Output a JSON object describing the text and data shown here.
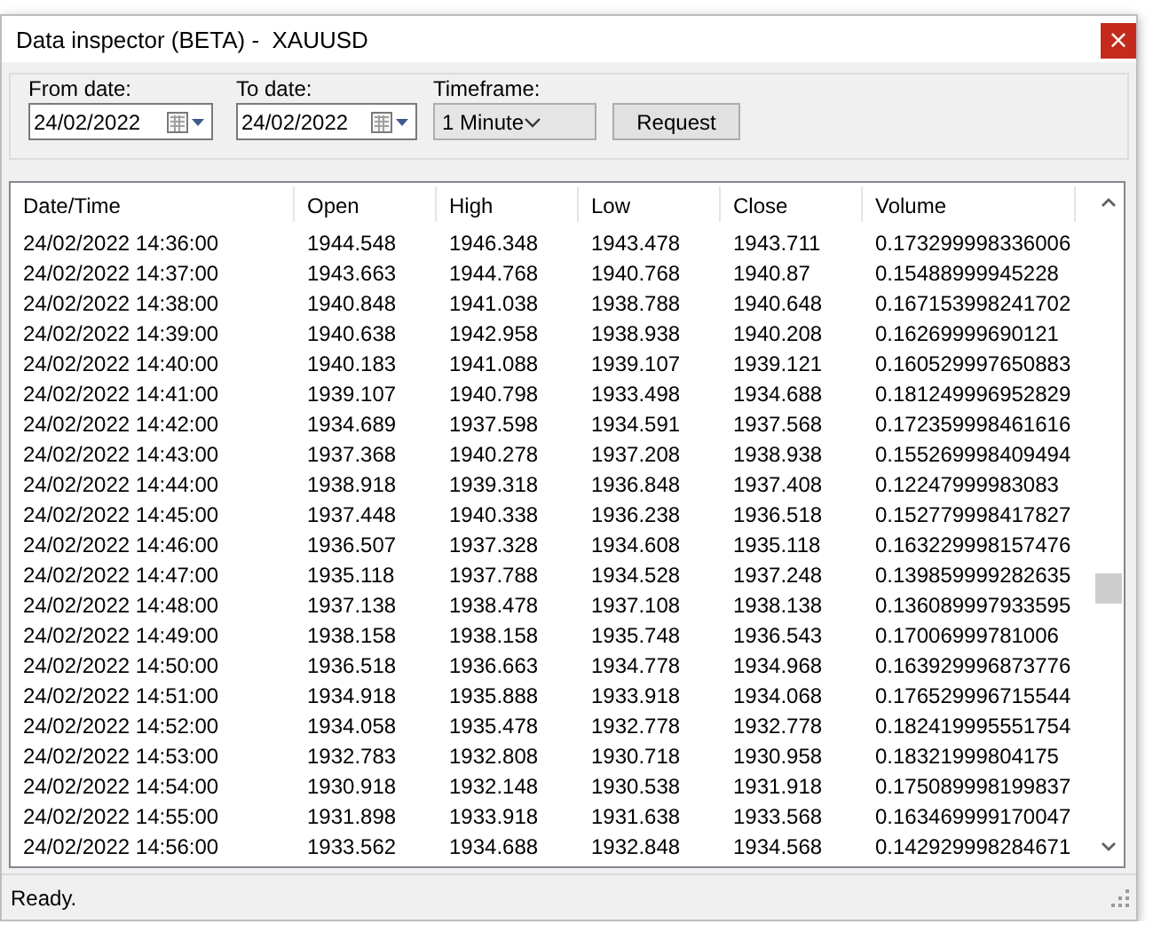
{
  "window": {
    "title": "Data inspector (BETA) -  XAUUSD",
    "close_glyph": "×"
  },
  "toolbar": {
    "from_date": {
      "label": "From date:",
      "value": "24/02/2022"
    },
    "to_date": {
      "label": "To date:",
      "value": "24/02/2022"
    },
    "timeframe": {
      "label": "Timeframe:",
      "value": "1 Minute"
    },
    "request_button": "Request"
  },
  "table": {
    "columns": [
      "Date/Time",
      "Open",
      "High",
      "Low",
      "Close",
      "Volume"
    ],
    "rows": [
      [
        "24/02/2022 14:36:00",
        "1944.548",
        "1946.348",
        "1943.478",
        "1943.711",
        "0.173299998336006"
      ],
      [
        "24/02/2022 14:37:00",
        "1943.663",
        "1944.768",
        "1940.768",
        "1940.87",
        "0.15488999945228"
      ],
      [
        "24/02/2022 14:38:00",
        "1940.848",
        "1941.038",
        "1938.788",
        "1940.648",
        "0.167153998241702"
      ],
      [
        "24/02/2022 14:39:00",
        "1940.638",
        "1942.958",
        "1938.938",
        "1940.208",
        "0.16269999690121"
      ],
      [
        "24/02/2022 14:40:00",
        "1940.183",
        "1941.088",
        "1939.107",
        "1939.121",
        "0.160529997650883"
      ],
      [
        "24/02/2022 14:41:00",
        "1939.107",
        "1940.798",
        "1933.498",
        "1934.688",
        "0.181249996952829"
      ],
      [
        "24/02/2022 14:42:00",
        "1934.689",
        "1937.598",
        "1934.591",
        "1937.568",
        "0.172359998461616"
      ],
      [
        "24/02/2022 14:43:00",
        "1937.368",
        "1940.278",
        "1937.208",
        "1938.938",
        "0.155269998409494"
      ],
      [
        "24/02/2022 14:44:00",
        "1938.918",
        "1939.318",
        "1936.848",
        "1937.408",
        "0.12247999983083"
      ],
      [
        "24/02/2022 14:45:00",
        "1937.448",
        "1940.338",
        "1936.238",
        "1936.518",
        "0.152779998417827"
      ],
      [
        "24/02/2022 14:46:00",
        "1936.507",
        "1937.328",
        "1934.608",
        "1935.118",
        "0.163229998157476"
      ],
      [
        "24/02/2022 14:47:00",
        "1935.118",
        "1937.788",
        "1934.528",
        "1937.248",
        "0.139859999282635"
      ],
      [
        "24/02/2022 14:48:00",
        "1937.138",
        "1938.478",
        "1937.108",
        "1938.138",
        "0.136089997933595"
      ],
      [
        "24/02/2022 14:49:00",
        "1938.158",
        "1938.158",
        "1935.748",
        "1936.543",
        "0.17006999781006"
      ],
      [
        "24/02/2022 14:50:00",
        "1936.518",
        "1936.663",
        "1934.778",
        "1934.968",
        "0.163929996873776"
      ],
      [
        "24/02/2022 14:51:00",
        "1934.918",
        "1935.888",
        "1933.918",
        "1934.068",
        "0.176529996715544"
      ],
      [
        "24/02/2022 14:52:00",
        "1934.058",
        "1935.478",
        "1932.778",
        "1932.778",
        "0.182419995551754"
      ],
      [
        "24/02/2022 14:53:00",
        "1932.783",
        "1932.808",
        "1930.718",
        "1930.958",
        "0.18321999804175"
      ],
      [
        "24/02/2022 14:54:00",
        "1930.918",
        "1932.148",
        "1930.538",
        "1931.918",
        "0.175089998199837"
      ],
      [
        "24/02/2022 14:55:00",
        "1931.898",
        "1933.918",
        "1931.638",
        "1933.568",
        "0.163469999170047"
      ],
      [
        "24/02/2022 14:56:00",
        "1933.562",
        "1934.688",
        "1932.848",
        "1934.568",
        "0.142929998284671"
      ]
    ]
  },
  "status_bar": "Ready."
}
